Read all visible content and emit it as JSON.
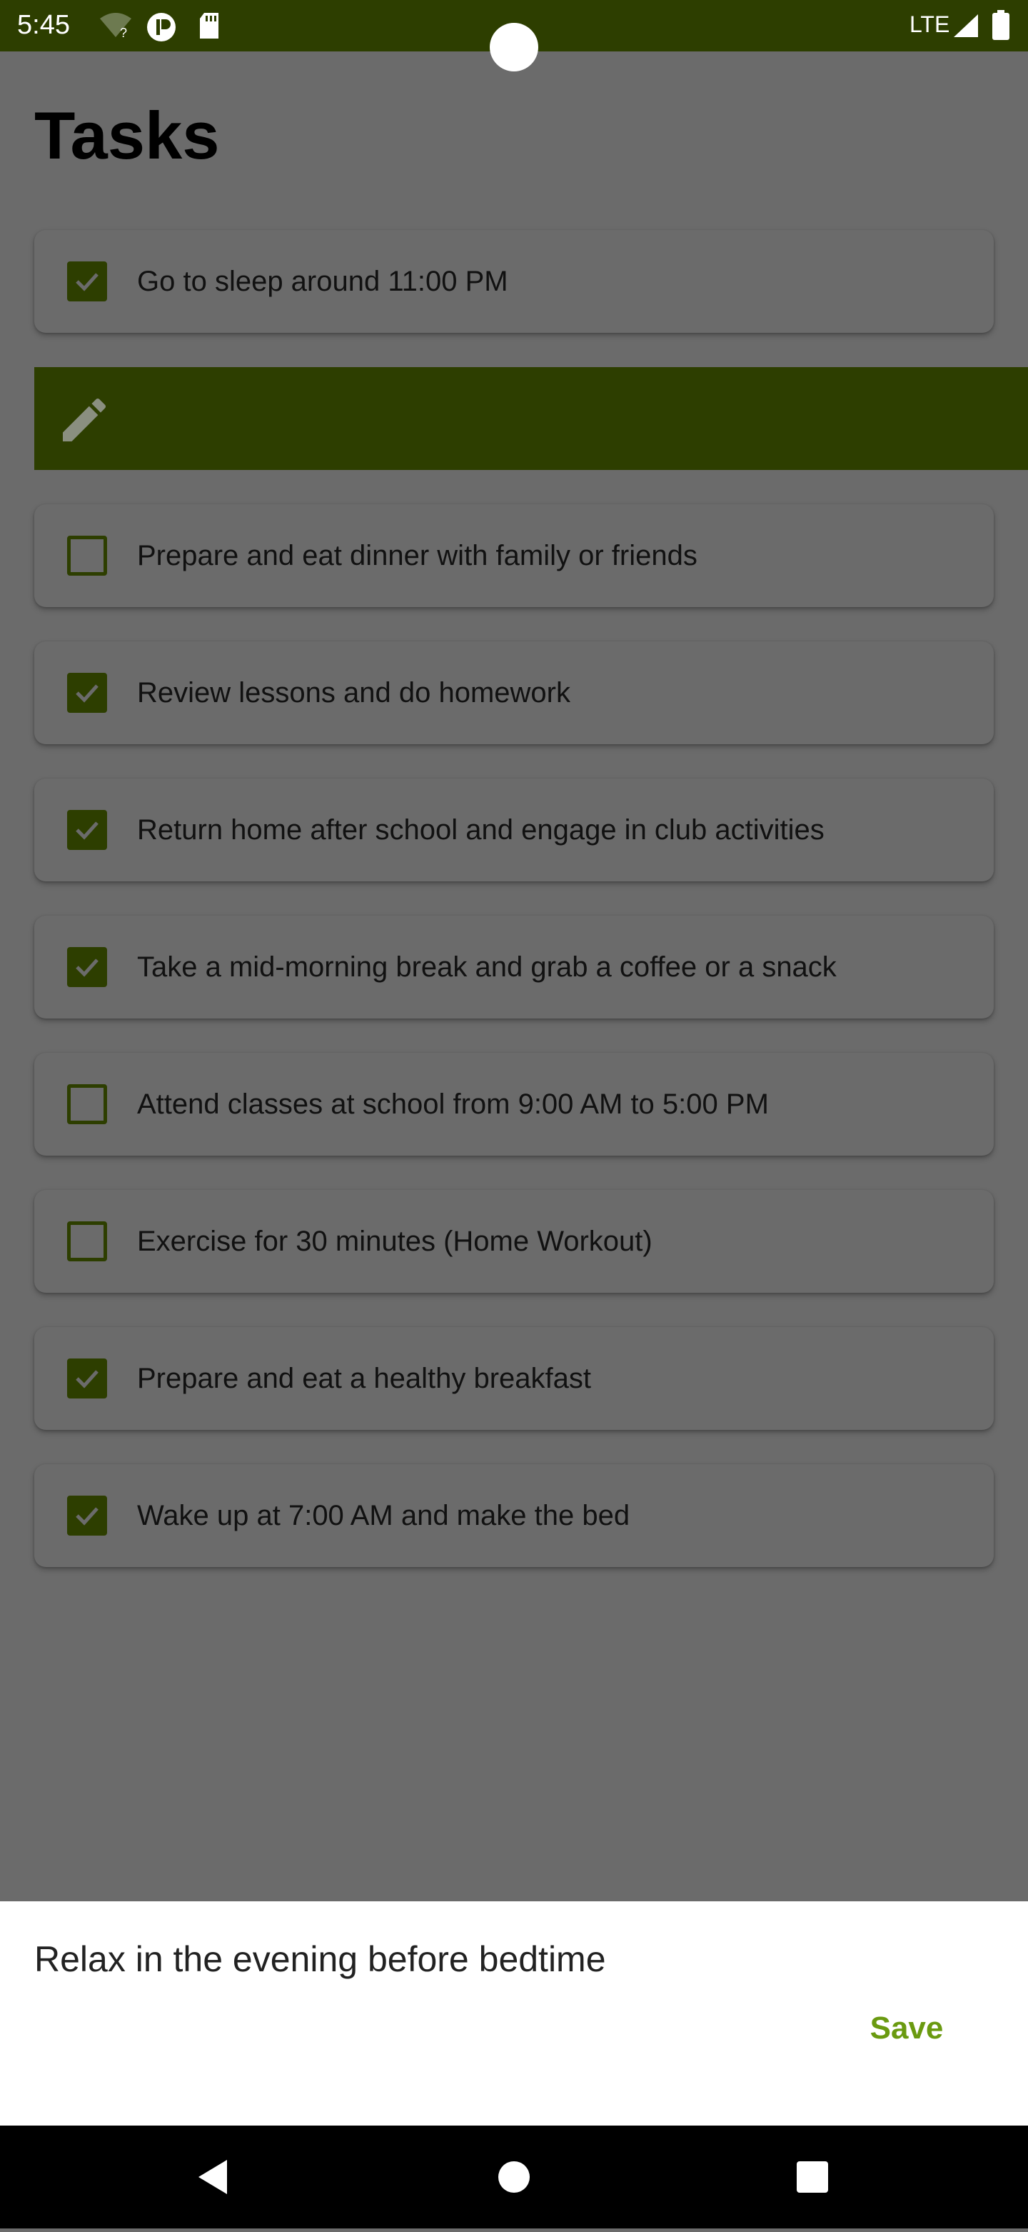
{
  "status_bar": {
    "time": "5:45",
    "network": "LTE",
    "icons": [
      "wifi-question-icon",
      "app-notification-icon",
      "sd-card-icon",
      "signal-icon",
      "battery-icon"
    ]
  },
  "page": {
    "title": "Tasks"
  },
  "tasks": [
    {
      "label": "Go to sleep around 11:00 PM",
      "checked": true
    },
    {
      "label": "Prepare and eat dinner with family or friends",
      "checked": false
    },
    {
      "label": "Review lessons and do homework",
      "checked": true
    },
    {
      "label": "Return home after school and engage in club activities",
      "checked": true
    },
    {
      "label": "Take a mid-morning break and grab a coffee or a snack",
      "checked": true
    },
    {
      "label": "Attend classes at school from 9:00 AM to 5:00 PM",
      "checked": false
    },
    {
      "label": "Exercise for 30 minutes (Home Workout)",
      "checked": false
    },
    {
      "label": "Prepare and eat a healthy breakfast",
      "checked": true
    },
    {
      "label": "Wake up at 7:00 AM and make the bed",
      "checked": true
    }
  ],
  "edit_sheet": {
    "value": "Relax in the evening before bedtime",
    "save_label": "Save"
  },
  "colors": {
    "accent": "#2d3e00",
    "save": "#6a9a10",
    "scrim": "#6b6b6b"
  }
}
